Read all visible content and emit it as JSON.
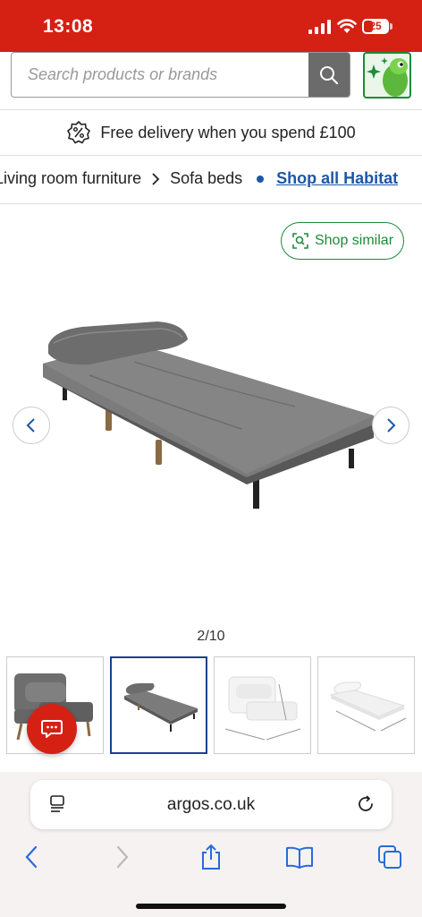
{
  "status_bar": {
    "time": "13:08",
    "battery": "25"
  },
  "search": {
    "placeholder": "Search products or brands"
  },
  "delivery": {
    "text": "Free delivery when you spend £100"
  },
  "breadcrumb": {
    "items": [
      "Living room furniture",
      "Sofa beds"
    ],
    "shop_all": "Shop all Habitat"
  },
  "gallery": {
    "shop_similar": "Shop similar",
    "counter": "2/10",
    "active_index": 2
  },
  "browser": {
    "url": "argos.co.uk"
  },
  "colors": {
    "brand_red": "#d42114",
    "link_blue": "#1c57a8",
    "green": "#1f8a3a"
  },
  "icons": [
    "search-icon",
    "percent-badge-icon",
    "chevron-right-icon",
    "shop-similar-icon",
    "chevron-left-icon",
    "chat-icon",
    "reader-icon",
    "reload-icon",
    "back-icon",
    "forward-icon",
    "share-icon",
    "bookmarks-icon",
    "tabs-icon"
  ]
}
